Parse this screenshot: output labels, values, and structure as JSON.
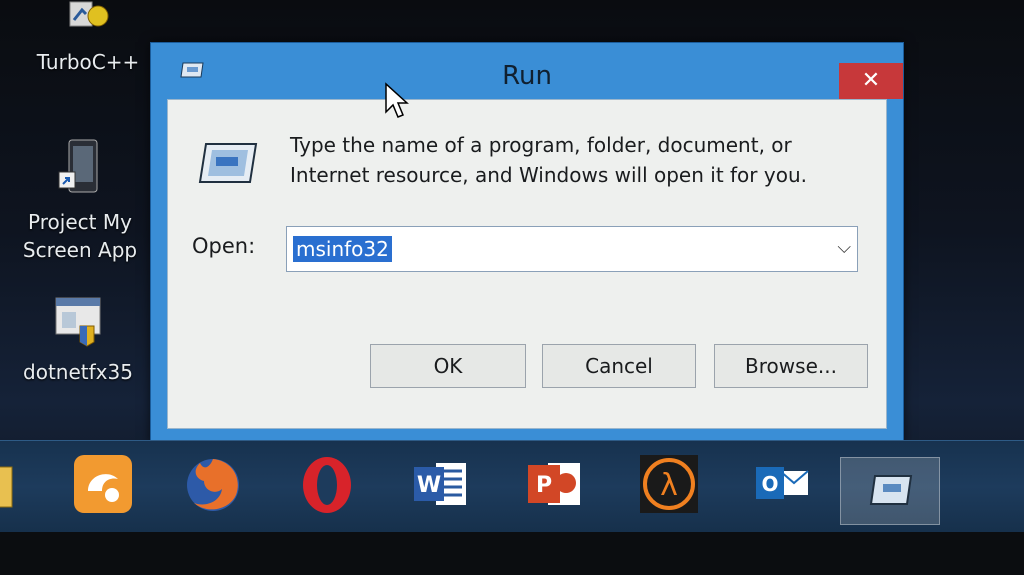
{
  "desktop": {
    "icons": [
      {
        "label": "TurboC++"
      },
      {
        "label": "Project My Screen App"
      },
      {
        "label": "dotnetfx35"
      }
    ]
  },
  "dialog": {
    "title": "Run",
    "close_glyph": "✕",
    "description": "Type the name of a program, folder, document, or Internet resource, and Windows will open it for you.",
    "open_label": "Open:",
    "open_value": "msinfo32",
    "buttons": {
      "ok": "OK",
      "cancel": "Cancel",
      "browse": "Browse..."
    },
    "accent": "#3a8ed6",
    "close_color": "#c7383a"
  },
  "taskbar": {
    "apps": [
      {
        "icon": "folder-icon"
      },
      {
        "icon": "uc-browser-icon"
      },
      {
        "icon": "firefox-icon"
      },
      {
        "icon": "opera-icon"
      },
      {
        "icon": "word-icon",
        "text": "W"
      },
      {
        "icon": "powerpoint-icon",
        "text": "P"
      },
      {
        "icon": "half-life-icon",
        "text": "λ"
      },
      {
        "icon": "outlook-icon",
        "text": "O"
      },
      {
        "icon": "run-icon"
      }
    ]
  }
}
